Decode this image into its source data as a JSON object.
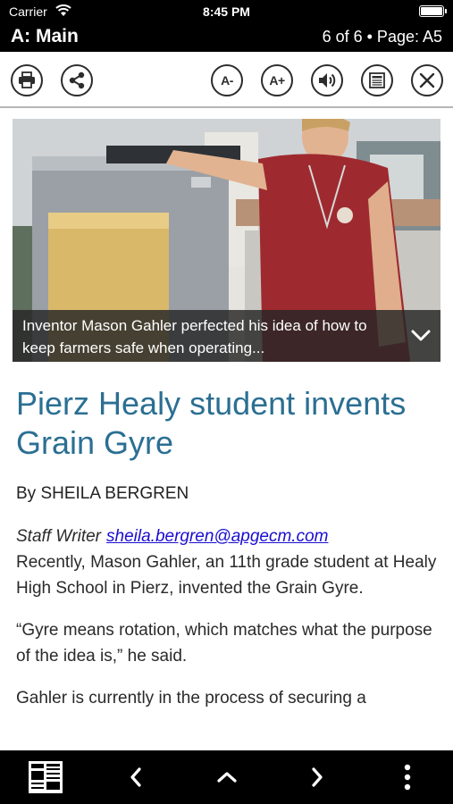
{
  "status_bar": {
    "carrier": "Carrier",
    "time": "8:45 PM"
  },
  "title_bar": {
    "section": "A: Main",
    "page_info": "6 of 6 • Page: A5"
  },
  "toolbar": {
    "buttons": [
      {
        "icon": "print-icon"
      },
      {
        "icon": "share-icon"
      },
      {
        "icon": "decrease-font-icon",
        "label": "A-"
      },
      {
        "icon": "increase-font-icon",
        "label": "A+"
      },
      {
        "icon": "speaker-icon"
      },
      {
        "icon": "article-view-icon"
      },
      {
        "icon": "close-icon"
      }
    ]
  },
  "photo": {
    "caption": "Inventor Mason Gahler perfected his idea of how to keep farmers safe when operating...",
    "expand_icon": "chevron-down-icon"
  },
  "article": {
    "headline": "Pierz Healy student invents Grain Gyre",
    "byline": "By SHEILA BERGREN",
    "role": "Staff Writer",
    "email": "sheila.bergren@apgecm.com",
    "paragraph1": "Recently, Mason Gahler, an 11th grade student at Healy High School in Pierz, invented the Grain Gyre.",
    "paragraph2": "“Gyre means rotation, which matches what the purpose of the idea is,” he said.",
    "paragraph3": "Gahler is currently in the process of securing a"
  },
  "bottom_bar": {
    "buttons": [
      "newspaper-icon",
      "chevron-left-icon",
      "chevron-up-icon",
      "chevron-right-icon",
      "more-vertical-icon"
    ]
  },
  "colors": {
    "headline": "#2b6f93",
    "link": "#1a0dcf",
    "bar_background": "#000000"
  }
}
